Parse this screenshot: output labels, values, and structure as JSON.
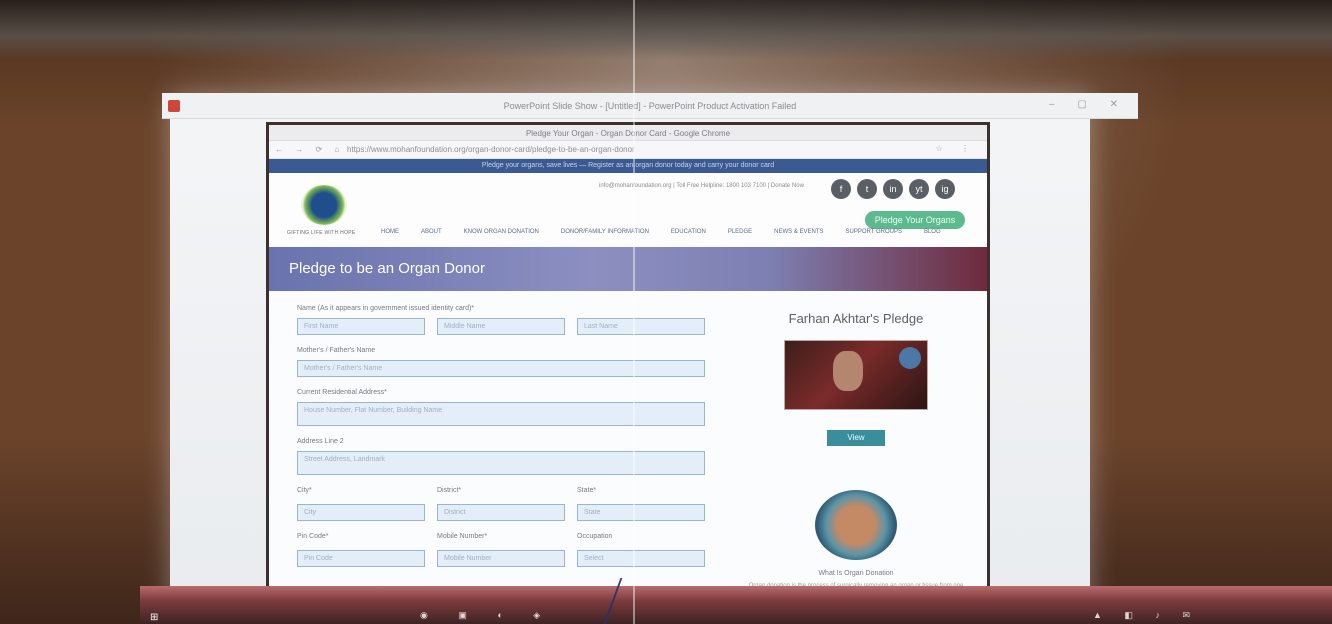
{
  "viewer": {
    "title": "PowerPoint Slide Show - [Untitled] - PowerPoint Product Activation Failed",
    "window_controls": "– ▢ ✕"
  },
  "browser": {
    "tab_title": "Pledge Your Organ - Organ Donor Card - Google Chrome",
    "nav_buttons": "← → ⟳ ⌂",
    "url": "https://www.mohanfoundation.org/organ-donor-card/pledge-to-be-an-organ-donor",
    "menu": "☆ ⋮"
  },
  "site": {
    "announcement": "Pledge your organs, save lives — Register as an organ donor today and carry your donor card",
    "logo_tagline": "GIFTING LIFE WITH HOPE",
    "contact_text": "info@mohanfoundation.org  |  Toll Free Helpline: 1800 103 7100  |  Donate Now",
    "social_icons": [
      "f",
      "t",
      "in",
      "yt",
      "ig"
    ],
    "cta_label": "Pledge Your Organs",
    "nav": [
      "HOME",
      "ABOUT",
      "KNOW ORGAN DONATION",
      "DONOR/FAMILY INFORMATION",
      "EDUCATION",
      "PLEDGE",
      "NEWS & EVENTS",
      "SUPPORT GROUPS",
      "BLOG"
    ]
  },
  "banner": {
    "title": "Pledge to be an Organ Donor"
  },
  "form": {
    "name_label": "Name (As it appears in government issued identity card)*",
    "first_name_placeholder": "First Name",
    "middle_name_placeholder": "Middle Name",
    "last_name_placeholder": "Last Name",
    "parent_label": "Mother's / Father's Name",
    "parent_placeholder": "Mother's / Father's Name",
    "address_label": "Current Residential Address*",
    "address_placeholder": "House Number, Flat Number, Building Name",
    "address2_label": "Address Line 2",
    "address2_placeholder": "Street Address, Landmark",
    "city_label": "City*",
    "city_placeholder": "City",
    "district_label": "District*",
    "district_placeholder": "District",
    "state_label": "State*",
    "state_placeholder": "State",
    "pincode_label": "Pin Code*",
    "pincode_placeholder": "Pin Code",
    "mobile_label": "Mobile Number*",
    "mobile_placeholder": "Mobile Number",
    "occupation_label": "Occupation",
    "occupation_placeholder": "Select"
  },
  "sidebar": {
    "pledge_title": "Farhan Akhtar's Pledge",
    "view_button": "View",
    "caption": "What Is Organ Donation",
    "blurb": "Organ donation is the process of surgically removing an organ or tissue from one person and placing it into another."
  },
  "taskbar": {
    "start": "⊞",
    "icons": "◉ ▣ ◐ ◈",
    "tray": "▲ ◧ ♪ ✉"
  }
}
